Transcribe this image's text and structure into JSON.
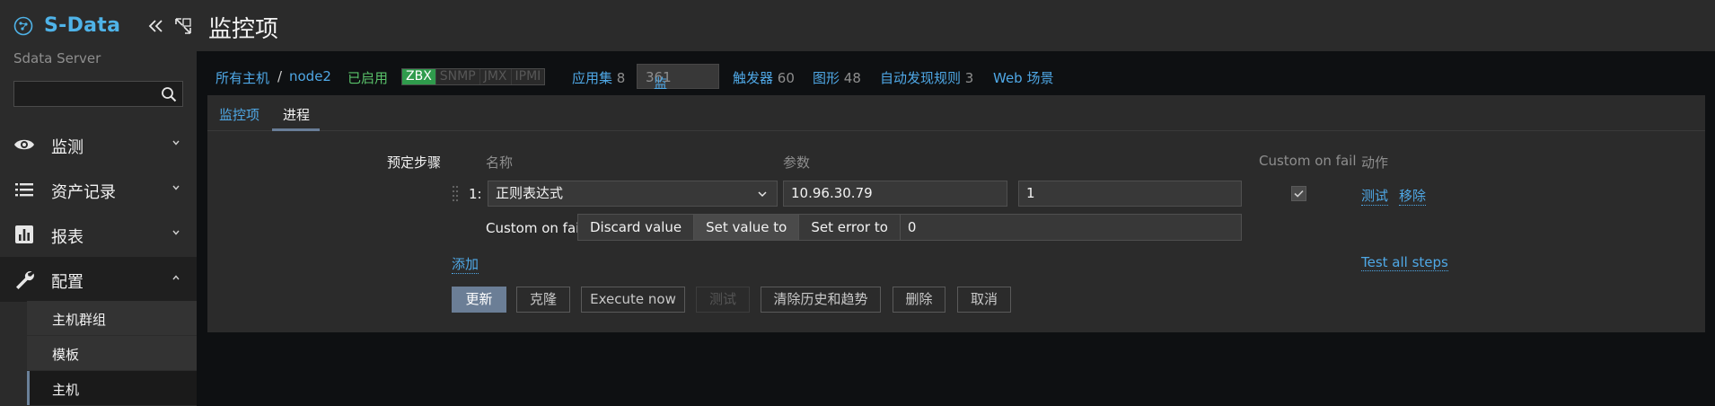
{
  "sidebar": {
    "logo_text": "S-Data",
    "server_name": "Sdata Server",
    "search": {
      "value": "",
      "placeholder": ""
    },
    "nav": [
      {
        "label": "监测",
        "icon": "eye-icon",
        "expanded": false
      },
      {
        "label": "资产记录",
        "icon": "list-icon",
        "expanded": false
      },
      {
        "label": "报表",
        "icon": "bar-chart-icon",
        "expanded": false
      },
      {
        "label": "配置",
        "icon": "wrench-icon",
        "expanded": true
      }
    ],
    "submenu": [
      {
        "label": "主机群组"
      },
      {
        "label": "模板"
      },
      {
        "label": "主机",
        "selected": true
      }
    ]
  },
  "header": {
    "title": "监控项"
  },
  "host_nav": {
    "all_hosts": "所有主机",
    "separator": "/",
    "host": "node2",
    "status": "已启用",
    "availability": [
      "ZBX",
      "SNMP",
      "JMX",
      "IPMI"
    ],
    "applications": {
      "label": "应用集",
      "count": "8"
    },
    "items": {
      "label": "监控项",
      "count": "361"
    },
    "triggers": {
      "label": "触发器",
      "count": "60"
    },
    "graphs": {
      "label": "图形",
      "count": "48"
    },
    "discovery": {
      "label": "自动发现规则",
      "count": "3"
    },
    "web": {
      "label": "Web 场景"
    }
  },
  "tabs": {
    "item": "监控项",
    "preprocessing": "进程"
  },
  "preprocessing": {
    "section_label": "预定步骤",
    "col_name": "名称",
    "col_params": "参数",
    "col_custom_fail": "Custom on fail",
    "col_actions": "动作",
    "step": {
      "index": "1:",
      "type": "正则表达式",
      "param1": "10.96.30.79",
      "param2": "1",
      "custom_on_fail_checked": true,
      "test_link": "测试",
      "remove_link": "移除"
    },
    "on_fail": {
      "label": "Custom on fail",
      "options": [
        "Discard value",
        "Set value to",
        "Set error to"
      ],
      "selected": "Set value to",
      "value": "0"
    },
    "add_link": "添加",
    "test_all_link": "Test all steps"
  },
  "buttons": {
    "update": "更新",
    "clone": "克隆",
    "execute_now": "Execute now",
    "test": "测试",
    "clear_history": "清除历史和趋势",
    "delete": "删除",
    "cancel": "取消"
  },
  "colors": {
    "link": "#4fa8e6",
    "enabled": "#59c26a",
    "zbx_badge": "#2f9b4c",
    "primary_button": "#6b7e96",
    "logo": "#4fb3e8"
  }
}
